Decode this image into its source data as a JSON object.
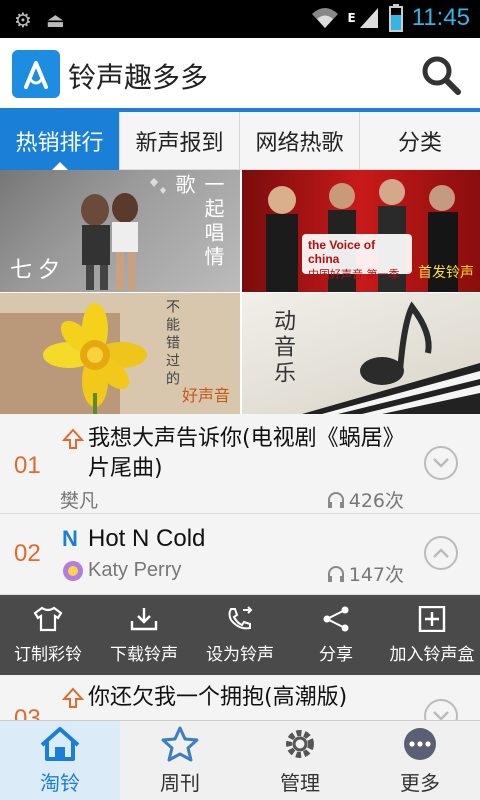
{
  "status_bar": {
    "time": "11:45",
    "network": "E"
  },
  "app": {
    "title": "铃声趣多多"
  },
  "tabs": [
    {
      "label": "热销排行",
      "active": true
    },
    {
      "label": "新声报到",
      "active": false
    },
    {
      "label": "网络热歌",
      "active": false
    },
    {
      "label": "分类",
      "active": false
    }
  ],
  "banners": {
    "b1": {
      "side_text": "一起唱情歌",
      "corner_text": "七夕"
    },
    "b2": {
      "logo_text": "the Voice of china",
      "sub_text": "中国好声音 第一季",
      "corner_text": "首发铃声"
    },
    "b3": {
      "side_text": "不能错过的",
      "corner_text": "好声音"
    },
    "b4": {
      "side_text": "动音乐"
    }
  },
  "songs": [
    {
      "rank": "01",
      "title": "我想大声告诉你(电视剧《蜗居》片尾曲)",
      "artist": "樊凡",
      "plays": "426次",
      "expanded": false
    },
    {
      "rank": "02",
      "title": "Hot N Cold",
      "artist": "Katy Perry",
      "plays": "147次",
      "expanded": true
    },
    {
      "rank": "03",
      "title": "你还欠我一个拥抱(高潮版)",
      "artist": "",
      "plays": "",
      "expanded": false
    }
  ],
  "actions": [
    {
      "label": "订制彩铃",
      "icon": "shirt-icon"
    },
    {
      "label": "下载铃声",
      "icon": "download-icon"
    },
    {
      "label": "设为铃声",
      "icon": "phone-icon"
    },
    {
      "label": "分享",
      "icon": "share-icon"
    },
    {
      "label": "加入铃声盒",
      "icon": "add-box-icon"
    }
  ],
  "nav": [
    {
      "label": "淘铃",
      "icon": "home-icon",
      "active": true
    },
    {
      "label": "周刊",
      "icon": "star-icon",
      "active": false
    },
    {
      "label": "管理",
      "icon": "gear-icon",
      "active": false
    },
    {
      "label": "更多",
      "icon": "more-icon",
      "active": false
    }
  ],
  "colors": {
    "accent": "#1a7fd6",
    "rank": "#e06a2a",
    "action_bar": "#4a4a4a"
  }
}
